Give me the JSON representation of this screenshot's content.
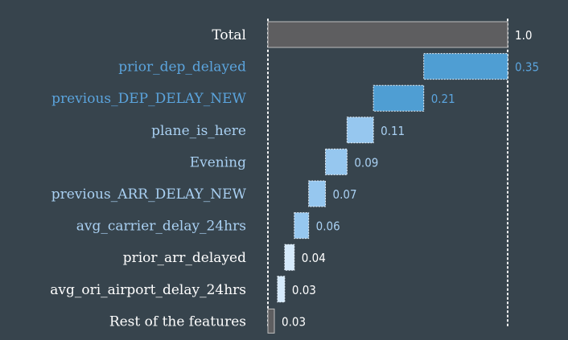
{
  "chart_data": {
    "type": "bar",
    "subtype": "waterfall-horizontal",
    "categories": [
      "Total",
      "prior_dep_delayed",
      "previous_DEP_DELAY_NEW",
      "plane_is_here",
      "Evening",
      "previous_ARR_DELAY_NEW",
      "avg_carrier_delay_24hrs",
      "prior_arr_delayed",
      "avg_ori_airport_delay_24hrs",
      "Rest of the features"
    ],
    "values": [
      1.0,
      0.35,
      0.21,
      0.11,
      0.09,
      0.07,
      0.06,
      0.04,
      0.03,
      0.03
    ],
    "value_labels": [
      "1.0",
      "0.35",
      "0.21",
      "0.11",
      "0.09",
      "0.07",
      "0.06",
      "0.04",
      "0.03",
      "0.03"
    ],
    "bar_colors": [
      "#5e5e60",
      "#4f9ed3",
      "#4f9ed3",
      "#96c7ef",
      "#96c7ef",
      "#96c7ef",
      "#96c7ef",
      "#d5eafb",
      "#d5eafb",
      "#5e5e60"
    ],
    "label_colors": [
      "#ffffff",
      "#5ba4dd",
      "#5ba4dd",
      "#a9d0f2",
      "#a9d0f2",
      "#a9d0f2",
      "#a9d0f2",
      "#ffffff",
      "#ffffff",
      "#ffffff"
    ],
    "value_label_colors": [
      "#ffffff",
      "#5ba4dd",
      "#5ba4dd",
      "#a9d0f2",
      "#a9d0f2",
      "#a9d0f2",
      "#a9d0f2",
      "#ffffff",
      "#ffffff",
      "#ffffff"
    ],
    "xlim": [
      0,
      1.0
    ],
    "reference_lines": [
      0,
      1.0
    ],
    "grid": false,
    "title": "",
    "xlabel": "",
    "ylabel": ""
  }
}
